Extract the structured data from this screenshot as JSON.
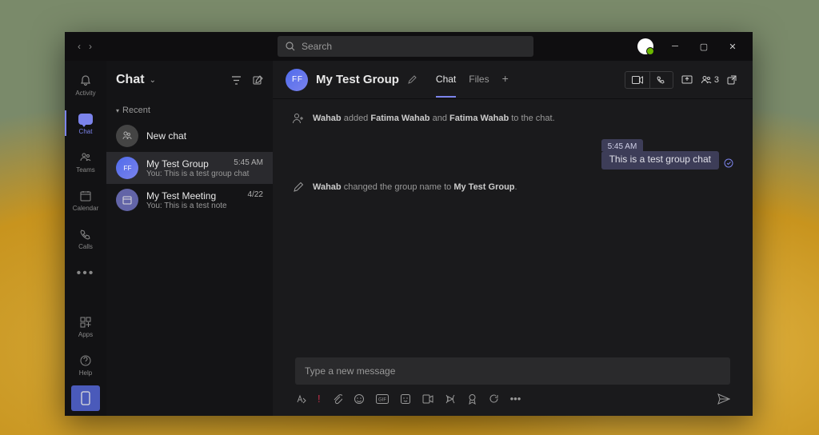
{
  "search": {
    "placeholder": "Search"
  },
  "rail": {
    "activity": "Activity",
    "chat": "Chat",
    "teams": "Teams",
    "calendar": "Calendar",
    "calls": "Calls",
    "apps": "Apps",
    "help": "Help"
  },
  "chatList": {
    "title": "Chat",
    "recent": "Recent",
    "items": [
      {
        "name": "New chat",
        "preview": "",
        "time": ""
      },
      {
        "name": "My Test Group",
        "preview": "You: This is a test group chat",
        "time": "5:45 AM"
      },
      {
        "name": "My Test Meeting",
        "preview": "You: This is a test note",
        "time": "4/22"
      }
    ]
  },
  "chatHeader": {
    "title": "My Test Group",
    "tabs": {
      "chat": "Chat",
      "files": "Files"
    },
    "people": "3"
  },
  "messages": {
    "system1": {
      "actor": "Wahab",
      "mid": " added ",
      "p1": "Fatima Wahab",
      "and": " and ",
      "p2": "Fatima Wahab",
      "tail": " to the chat."
    },
    "system2": {
      "actor": "Wahab",
      "mid": " changed the group name to ",
      "name": "My Test Group",
      "tail": "."
    },
    "msg1": {
      "time": "5:45 AM",
      "text": "This is a test group chat"
    }
  },
  "compose": {
    "placeholder": "Type a new message"
  }
}
